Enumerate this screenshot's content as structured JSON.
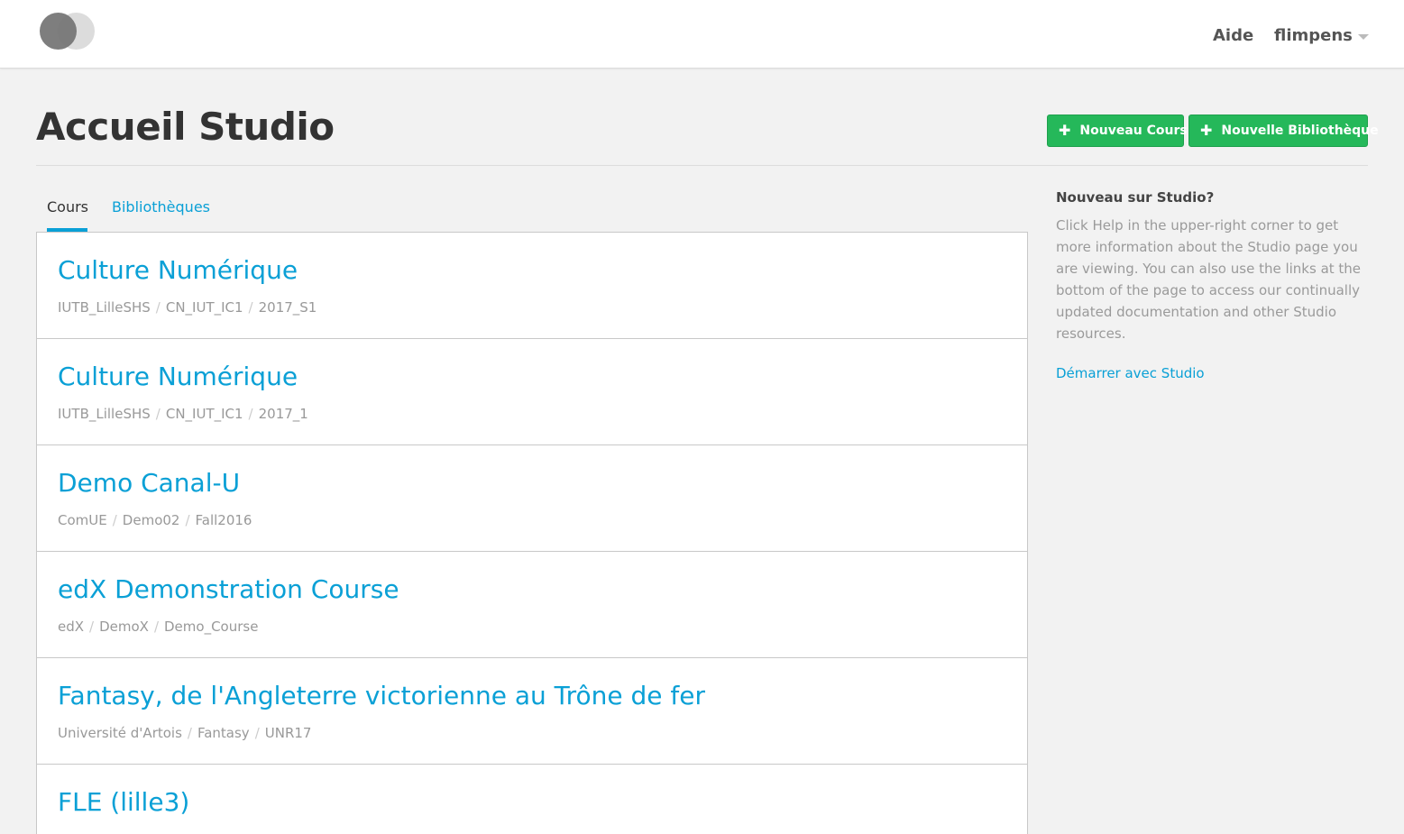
{
  "header": {
    "help_label": "Aide",
    "username": "flimpens"
  },
  "page": {
    "title": "Accueil Studio",
    "new_course_label": "Nouveau Cours",
    "new_library_label": "Nouvelle Bibliothèque"
  },
  "tabs": [
    {
      "label": "Cours",
      "active": true
    },
    {
      "label": "Bibliothèques",
      "active": false
    }
  ],
  "courses": [
    {
      "title": "Culture Numérique",
      "org": "IUTB_LilleSHS",
      "number": "CN_IUT_IC1",
      "run": "2017_S1"
    },
    {
      "title": "Culture Numérique",
      "org": "IUTB_LilleSHS",
      "number": "CN_IUT_IC1",
      "run": "2017_1"
    },
    {
      "title": "Demo Canal-U",
      "org": "ComUE",
      "number": "Demo02",
      "run": "Fall2016"
    },
    {
      "title": "edX Demonstration Course",
      "org": "edX",
      "number": "DemoX",
      "run": "Demo_Course"
    },
    {
      "title": "Fantasy, de l'Angleterre victorienne au Trône de fer",
      "org": "Université d'Artois",
      "number": "Fantasy",
      "run": "UNR17"
    },
    {
      "title": "FLE (lille3)",
      "org": "",
      "number": "",
      "run": ""
    }
  ],
  "sidebar": {
    "title": "Nouveau sur Studio?",
    "text": "Click Help in the upper-right corner to get more information about the Studio page you are viewing. You can also use the links at the bottom of the page to access our continually updated documentation and other Studio resources.",
    "link_label": "Démarrer avec Studio"
  },
  "colors": {
    "accent": "#0aa0d6",
    "button_green": "#25b85a",
    "background": "#f2f2f2"
  },
  "icons": {
    "logo": "edx-studio-logo",
    "user_menu": "caret-down-icon",
    "add": "plus-icon"
  }
}
